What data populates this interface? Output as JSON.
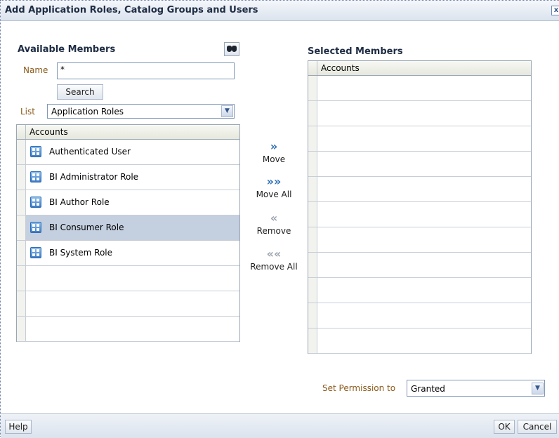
{
  "dialog": {
    "title": "Add Application Roles, Catalog Groups and Users",
    "close_glyph": "x"
  },
  "available": {
    "heading": "Available Members",
    "search_icon": "binoculars-icon",
    "name_label": "Name",
    "name_value": "*",
    "search_button": "Search",
    "list_label": "List",
    "list_value": "Application Roles",
    "column_header": "Accounts",
    "rows": [
      {
        "label": "Authenticated User",
        "selected": false
      },
      {
        "label": "BI Administrator Role",
        "selected": false
      },
      {
        "label": "BI Author Role",
        "selected": false
      },
      {
        "label": "BI Consumer Role",
        "selected": true
      },
      {
        "label": "BI System Role",
        "selected": false
      },
      {
        "label": "",
        "selected": false
      },
      {
        "label": "",
        "selected": false
      },
      {
        "label": "",
        "selected": false
      }
    ]
  },
  "shuttle": {
    "move": {
      "glyph": "»",
      "label": "Move"
    },
    "move_all": {
      "glyph": "»»",
      "label": "Move All"
    },
    "remove": {
      "glyph": "«",
      "label": "Remove"
    },
    "remove_all": {
      "glyph": "««",
      "label": "Remove All"
    }
  },
  "selected": {
    "heading": "Selected Members",
    "column_header": "Accounts",
    "row_count": 11
  },
  "permission": {
    "label": "Set Permission to",
    "value": "Granted"
  },
  "footer": {
    "help": "Help",
    "ok": "OK",
    "cancel": "Cancel"
  },
  "colors": {
    "accent": "#2e6fb5",
    "selected_row": "#c4cfdf",
    "label": "#8b5a1b"
  }
}
